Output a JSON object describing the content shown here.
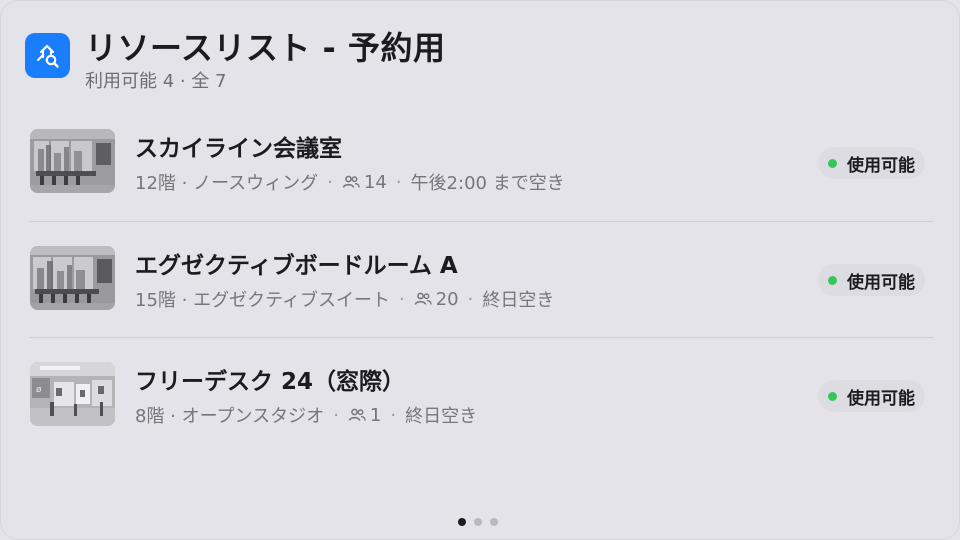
{
  "header": {
    "title": "リソースリスト - 予約用",
    "subtitle": "利用可能 4 · 全 7",
    "icon": "room-search-icon",
    "accent": "#1a7dfb"
  },
  "resources": [
    {
      "name": "スカイライン会議室",
      "floor": "12階 · ノースウィング",
      "capacity": "14",
      "availability": "午後2:00 まで空き",
      "status": "使用可能",
      "thumbnail": "conference-room-photo"
    },
    {
      "name": "エグゼクティブボードルーム A",
      "floor": "15階 · エグゼクティブスイート",
      "capacity": "20",
      "availability": "終日空き",
      "status": "使用可能",
      "thumbnail": "boardroom-photo"
    },
    {
      "name": "フリーデスク 24（窓際）",
      "floor": "8階 · オープンスタジオ",
      "capacity": "1",
      "availability": "終日空き",
      "status": "使用可能",
      "thumbnail": "open-office-photo"
    }
  ],
  "status_color": "#34c759",
  "pager": {
    "pages": 3,
    "current": 1
  }
}
